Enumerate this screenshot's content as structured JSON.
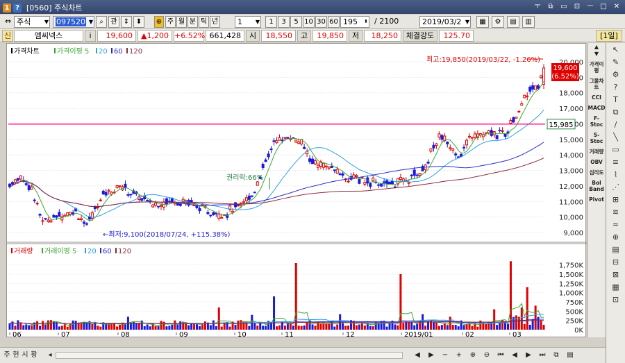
{
  "window": {
    "title": "[0560] 주식차트",
    "badge1": "1",
    "badge2": "?",
    "controls": [
      "ㅜ",
      "⧉",
      "▭",
      "⊡",
      "ㅡ",
      "□",
      "✕"
    ]
  },
  "toolbar": {
    "market": "주식",
    "code": "097520",
    "search_icon": "⌕",
    "tab_label": "관",
    "period_buttons": [
      "주",
      "월",
      "분",
      "틱",
      "년"
    ],
    "period_num": "1",
    "quick": [
      "1",
      "3",
      "5",
      "10",
      "30",
      "60"
    ],
    "count": "195",
    "total": "/ 2100",
    "date": "2019/03/2"
  },
  "stock": {
    "market_badge": "신",
    "name": "엠씨넥스",
    "info": "i",
    "price": "19,600",
    "change": "▲1,200",
    "change_pct": "+6.52%",
    "volume": "661,428",
    "open_label": "시",
    "open": "18,550",
    "high_label": "고",
    "high": "19,850",
    "low_label": "저",
    "low": "18,250",
    "strength_label": "체결강도",
    "strength": "125.70",
    "period_badge": "[1일]"
  },
  "price_panel": {
    "legend": [
      "가격차트",
      "가격이평 5",
      "20",
      "60",
      "120"
    ],
    "max_annot": "최고:19,850(2019/03/22, -1.26%)",
    "min_annot": "←최저:9,100(2018/07/24, +115.38%)",
    "ex_annot": "권리락:66%",
    "current_label": "19,600",
    "current_pct": "(6.52%)",
    "line_label": "15,985",
    "y_ticks": [
      "20,000",
      "19,000",
      "18,000",
      "17,000",
      "16,000",
      "15,000",
      "14,000",
      "13,000",
      "12,000",
      "11,000",
      "10,000",
      "9,000"
    ]
  },
  "volume_panel": {
    "legend": [
      "거래량",
      "거래이평 5",
      "20",
      "60",
      "120"
    ],
    "y_ticks": [
      "1,750K",
      "1,500K",
      "1,250K",
      "1,000K",
      "750K",
      "500K",
      "250K",
      "0K"
    ]
  },
  "x_axis": [
    "06",
    "07",
    "08",
    "09",
    "10",
    "11",
    "12",
    "2019/01",
    "02",
    "03"
  ],
  "sidebar_items": [
    "가격이평",
    "그물차트",
    "CCI",
    "MACD",
    "F-Stoc",
    "S-Stoc",
    "거래량",
    "OBV",
    "심리도",
    "Bol Band",
    "Pivot"
  ],
  "bottom": {
    "labels": [
      "주",
      "현",
      "시",
      "황"
    ],
    "nav": [
      "◀",
      "▶",
      "−",
      "+",
      "⊕",
      "⊖",
      "⏮",
      "◀",
      "▶",
      "⏭",
      "⧉",
      "▤"
    ]
  },
  "colors": {
    "up": "#e00000",
    "down": "#1a1adc",
    "ma5": "#3aa832",
    "ma20": "#2ca0e6",
    "ma60": "#2a2acc",
    "ma120": "#8a2a3a",
    "line": "#ff1493"
  }
}
